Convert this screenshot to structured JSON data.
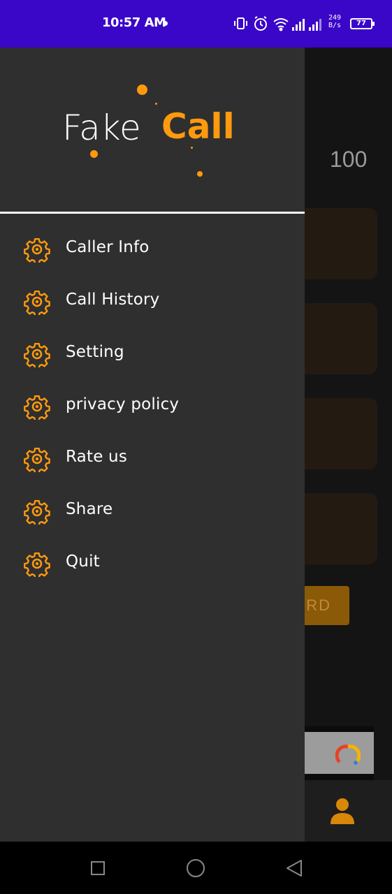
{
  "status_bar": {
    "time": "10:57 AM",
    "speed_value": "249",
    "speed_unit": "B/s",
    "battery": "77",
    "background_color": "#3a06c8"
  },
  "background_app": {
    "value": "100",
    "button_label_fragment": "RD",
    "accent_color": "#ff9a0e"
  },
  "drawer": {
    "logo": {
      "fake": "Fake",
      "call": "Call"
    },
    "menu": [
      {
        "label": "Caller Info",
        "icon": "gear-icon"
      },
      {
        "label": "Call History",
        "icon": "gear-icon"
      },
      {
        "label": "Setting",
        "icon": "gear-icon"
      },
      {
        "label": "privacy policy",
        "icon": "gear-icon"
      },
      {
        "label": "Rate us",
        "icon": "gear-icon"
      },
      {
        "label": "Share",
        "icon": "gear-icon"
      },
      {
        "label": "Quit",
        "icon": "gear-icon"
      }
    ]
  },
  "system_nav": {
    "icons": [
      "recent-apps-icon",
      "home-icon",
      "back-icon"
    ]
  }
}
